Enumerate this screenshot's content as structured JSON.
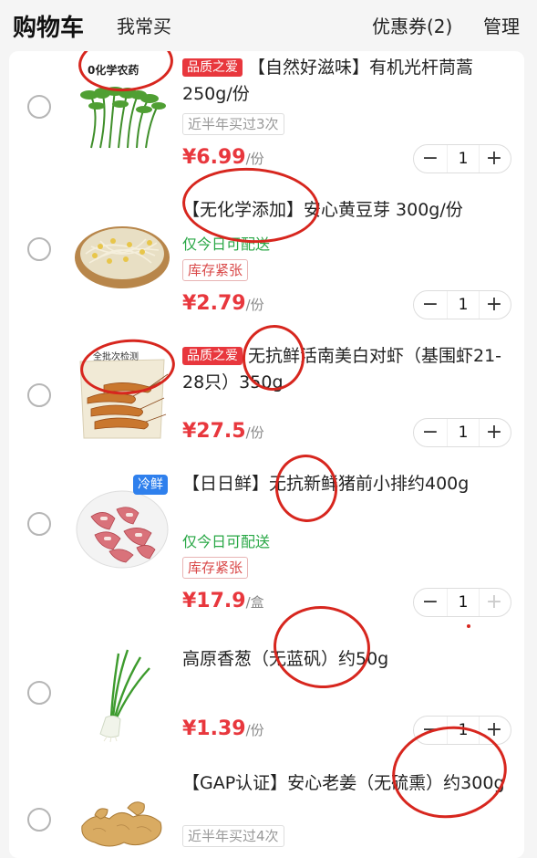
{
  "header": {
    "title": "购物车",
    "frequent": "我常买",
    "coupon": "优惠券(2)",
    "manage": "管理"
  },
  "items": [
    {
      "image_text": "0化学农药",
      "quality_tag": "品质之爱",
      "name": "【自然好滋味】有机光杆茼蒿250g/份",
      "grey_tag": "近半年买过3次",
      "price": "¥6.99",
      "unit": "/份",
      "qty": "1"
    },
    {
      "name": "【无化学添加】安心黄豆芽 300g/份",
      "green_note": "仅今日可配送",
      "stock_tag": "库存紧张",
      "price": "¥2.79",
      "unit": "/份",
      "qty": "1"
    },
    {
      "image_text": "全批次检测",
      "quality_tag": "品质之爱",
      "name": "无抗鲜活南美白对虾（基围虾21-28只）350g",
      "price": "¥27.5",
      "unit": "/份",
      "qty": "1"
    },
    {
      "cold_badge": "冷鲜",
      "name": "【日日鲜】无抗新鲜猪前小排约400g",
      "green_note": "仅今日可配送",
      "stock_tag": "库存紧张",
      "price": "¥17.9",
      "unit": "/盒",
      "qty": "1"
    },
    {
      "name": "高原香葱（无蓝矾）约50g",
      "price": "¥1.39",
      "unit": "/份",
      "qty": "1"
    },
    {
      "name": "【GAP认证】安心老姜（无硫熏）约300g",
      "grey_tag": "近半年买过4次"
    }
  ],
  "stepper": {
    "minus": "−",
    "plus": "+"
  },
  "colors": {
    "price_red": "#e8373d",
    "green_note": "#28a745",
    "cold_blue": "#2f80ed",
    "annotation_red": "#d7261e"
  }
}
